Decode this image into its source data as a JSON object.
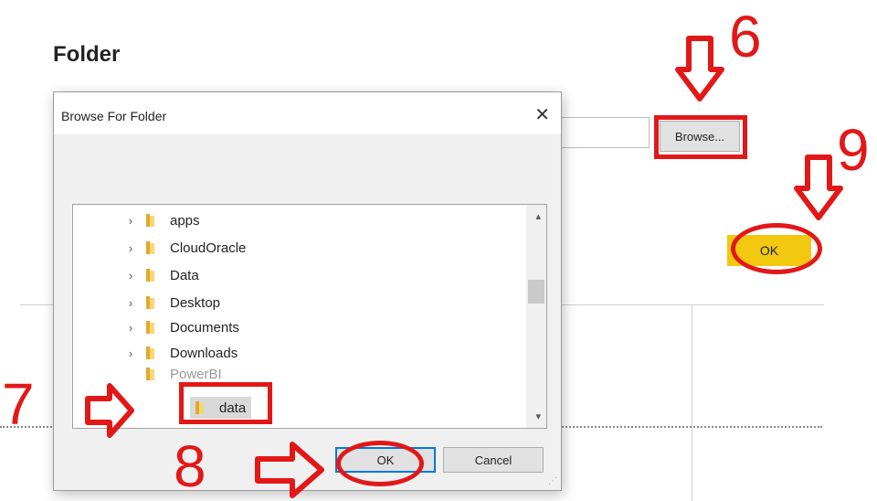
{
  "page": {
    "title": "Folder"
  },
  "browse_button": {
    "label": "Browse..."
  },
  "ok_button": {
    "label": "OK"
  },
  "dialog": {
    "title": "Browse For Folder",
    "close_glyph": "✕",
    "tree": [
      {
        "label": "apps",
        "expanded": false
      },
      {
        "label": "CloudOracle",
        "expanded": false
      },
      {
        "label": "Data",
        "expanded": false
      },
      {
        "label": "Desktop",
        "expanded": false
      },
      {
        "label": "Documents",
        "expanded": false
      },
      {
        "label": "Downloads",
        "expanded": false
      },
      {
        "label": "PowerBI",
        "expanded": true
      },
      {
        "label": "data",
        "selected": true
      }
    ],
    "ok_label": "OK",
    "cancel_label": "Cancel"
  },
  "annotations": {
    "step6": "6",
    "step7": "7",
    "step8": "8",
    "step9": "9"
  },
  "colors": {
    "annotation": "#e21818",
    "accent_button": "#f2c811",
    "folder": "#f8d775"
  }
}
